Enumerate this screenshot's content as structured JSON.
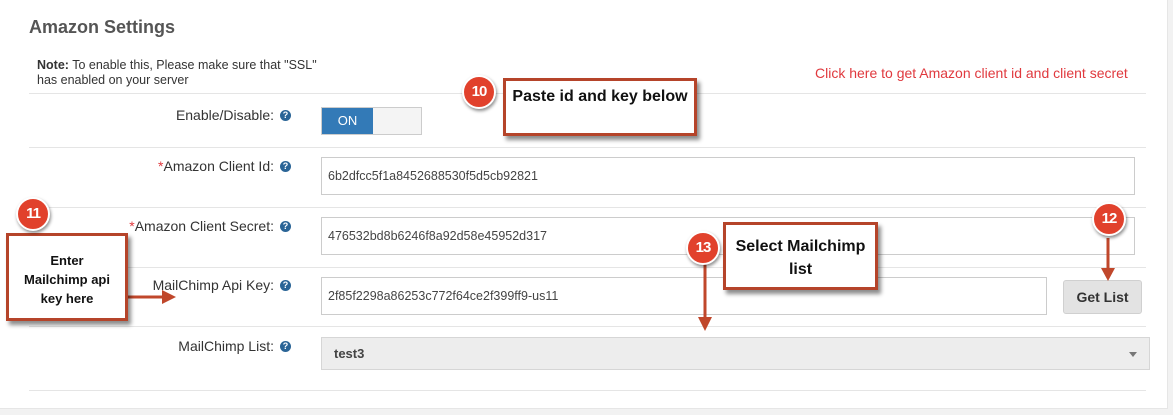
{
  "section": {
    "title": "Amazon Settings",
    "note_label": "Note:",
    "note_text": " To enable this, Please make sure that \"SSL\" has enabled on your server",
    "client_link": "Click here to get Amazon client id and client secret"
  },
  "fields": {
    "enable": {
      "label": "Enable/Disable:",
      "toggle_on_label": "ON",
      "value": "ON"
    },
    "client_id": {
      "required_mark": "*",
      "label": "Amazon Client Id:",
      "value": "6b2dfcc5f1a8452688530f5d5cb92821"
    },
    "client_secret": {
      "required_mark": "*",
      "label": "Amazon Client Secret:",
      "value": "476532bd8b6246f8a92d58e45952d317"
    },
    "api_key": {
      "label": "MailChimp Api Key:",
      "value": "2f85f2298a86253c772f64ce2f399ff9-us11",
      "button_label": "Get List"
    },
    "list": {
      "label": "MailChimp List:",
      "selected": "test3"
    }
  },
  "help_icon_glyph": "?",
  "annotations": {
    "badges": [
      "10",
      "11",
      "12",
      "13"
    ],
    "callout_10": "Paste id and key below",
    "callout_11": "Enter Mailchimp api key here",
    "callout_13": "Select Mailchimp list",
    "accent_color": "#b5442a",
    "badge_color": "#e1412c"
  },
  "colors": {
    "link": "#e0393e",
    "toggle_on": "#337ab7",
    "help_icon": "#2a6496"
  }
}
